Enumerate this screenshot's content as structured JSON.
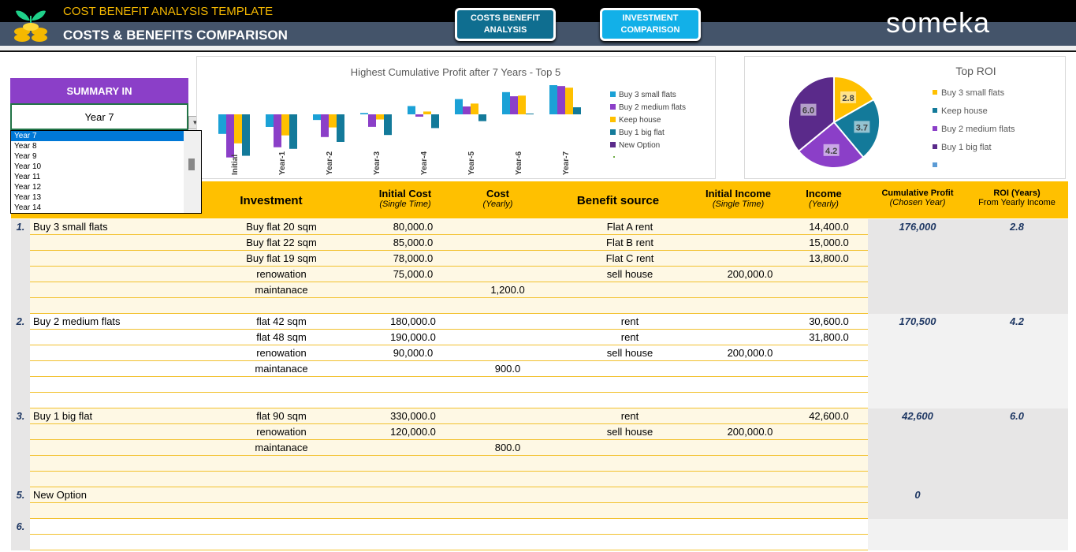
{
  "header": {
    "title": "COST BENEFIT ANALYSIS TEMPLATE",
    "subtitle": "COSTS & BENEFITS COMPARISON",
    "nav": [
      "COSTS BENEFIT ANALYSIS",
      "INVESTMENT COMPARISON"
    ],
    "brand": "someka",
    "logo_icon": "coins-sprout-icon"
  },
  "summary": {
    "label": "SUMMARY IN",
    "selected": "Year 7",
    "options": [
      "Year 7",
      "Year 8",
      "Year 9",
      "Year 10",
      "Year 11",
      "Year 12",
      "Year 13",
      "Year 14"
    ]
  },
  "colors": {
    "accent": "#ffc000",
    "purple": "#8b3fc8",
    "header_dark": "#44546a",
    "s1": "#1ba1d6",
    "s2": "#8b3fc8",
    "s3": "#ffc000",
    "s4": "#137a9a",
    "s5": "#5a2a8a"
  },
  "chart_data": [
    {
      "type": "bar",
      "title": "Highest Cumulative Profit after 7 Years - Top 5",
      "categories": [
        "Initial",
        "Year-1",
        "Year-2",
        "Year-3",
        "Year-4",
        "Year-5",
        "Year-6",
        "Year-7"
      ],
      "series": [
        {
          "name": "Buy 3 small flats",
          "color": "#1ba1d6",
          "values": [
            -118000,
            -76000,
            -34000,
            8000,
            50000,
            92000,
            134000,
            176000
          ]
        },
        {
          "name": "Buy 2 medium flats",
          "color": "#8b3fc8",
          "values": [
            -260000,
            -198500,
            -137000,
            -75500,
            -14000,
            47500,
            109000,
            170500
          ]
        },
        {
          "name": "Keep house",
          "color": "#ffc000",
          "values": [
            -175000,
            -127000,
            -79000,
            -31000,
            17000,
            65000,
            113000,
            161000
          ]
        },
        {
          "name": "Buy 1 big flat",
          "color": "#137a9a",
          "values": [
            -250000,
            -208200,
            -166400,
            -124600,
            -82800,
            -41000,
            800,
            42600
          ]
        },
        {
          "name": "New Option",
          "color": "#5a2a8a",
          "values": [
            0,
            0,
            0,
            0,
            0,
            0,
            0,
            0
          ]
        }
      ],
      "legend_position": "right",
      "grid": false
    },
    {
      "type": "pie",
      "title": "Top ROI",
      "slices": [
        {
          "name": "Buy 3 small flats",
          "value": 2.8,
          "label": "2.8",
          "color": "#ffc000"
        },
        {
          "name": "Keep house",
          "value": 3.7,
          "label": "3.7",
          "color": "#137a9a"
        },
        {
          "name": "Buy 2 medium flats",
          "value": 4.2,
          "label": "4.2",
          "color": "#8b3fc8"
        },
        {
          "name": "Buy 1 big flat",
          "value": 6.0,
          "label": "6.0",
          "color": "#5a2a8a"
        },
        {
          "name": "",
          "value": 0,
          "label": "",
          "color": "#5b9bd5"
        }
      ],
      "legend_position": "right"
    }
  ],
  "table": {
    "headers": {
      "investment": "Investment",
      "initial_cost": "Initial Cost",
      "initial_cost_sub": "(Single Time)",
      "cost": "Cost",
      "cost_sub": "(Yearly)",
      "benefit": "Benefit source",
      "initial_income": "Initial Income",
      "initial_income_sub": "(Single Time)",
      "income": "Income",
      "income_sub": "(Yearly)",
      "cum": "Cumulative Profit",
      "cum_sub": "(Chosen Year)",
      "roi": "ROI (Years)",
      "roi_sub": "From Yearly Income"
    },
    "groups": [
      {
        "num": "1.",
        "name": "Buy 3 small flats",
        "cum": "176,000",
        "roi": "2.8",
        "rows": 6,
        "items": [
          [
            "Buy flat 20 sqm",
            "80,000.0",
            "",
            "Flat A rent",
            "",
            "14,400.0"
          ],
          [
            "Buy flat 22 sqm",
            "85,000.0",
            "",
            "Flat B rent",
            "",
            "15,000.0"
          ],
          [
            "Buy flat 19 sqm",
            "78,000.0",
            "",
            "Flat C rent",
            "",
            "13,800.0"
          ],
          [
            "renowation",
            "75,000.0",
            "",
            "sell house",
            "200,000.0",
            ""
          ],
          [
            "maintanace",
            "",
            "1,200.0",
            "",
            "",
            ""
          ]
        ]
      },
      {
        "num": "2.",
        "name": "Buy 2 medium flats",
        "cum": "170,500",
        "roi": "4.2",
        "rows": 6,
        "items": [
          [
            "flat 42 sqm",
            "180,000.0",
            "",
            "rent",
            "",
            "30,600.0"
          ],
          [
            "flat 48 sqm",
            "190,000.0",
            "",
            "rent",
            "",
            "31,800.0"
          ],
          [
            "renowation",
            "90,000.0",
            "",
            "sell house",
            "200,000.0",
            ""
          ],
          [
            "maintanace",
            "",
            "900.0",
            "",
            "",
            ""
          ]
        ]
      },
      {
        "num": "3.",
        "name": "Buy 1 big flat",
        "cum": "42,600",
        "roi": "6.0",
        "rows": 5,
        "items": [
          [
            "flat 90 sqm",
            "330,000.0",
            "",
            "rent",
            "",
            "42,600.0"
          ],
          [
            "renowation",
            "120,000.0",
            "",
            "sell house",
            "200,000.0",
            ""
          ],
          [
            "maintanace",
            "",
            "800.0",
            "",
            "",
            ""
          ]
        ]
      },
      {
        "num": "5.",
        "name": "New Option",
        "cum": "0",
        "roi": "",
        "rows": 2,
        "items": []
      },
      {
        "num": "6.",
        "name": "",
        "cum": "",
        "roi": "",
        "rows": 2,
        "items": []
      }
    ]
  }
}
